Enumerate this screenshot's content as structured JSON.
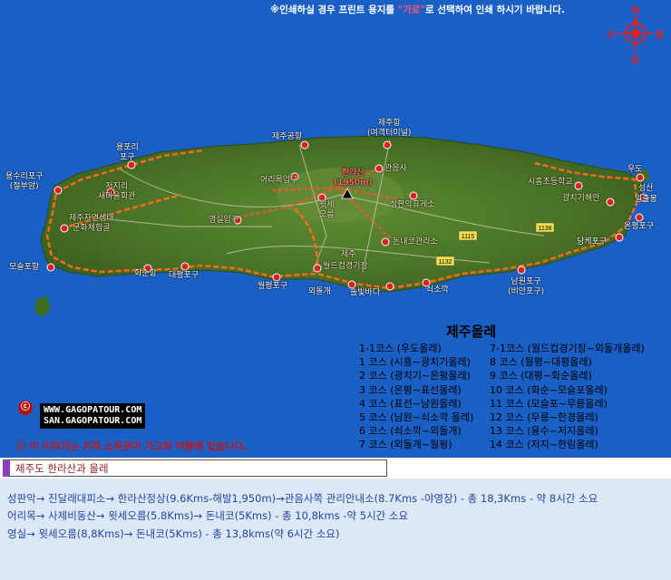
{
  "notice": {
    "before": "※인쇄하실 경우 프린트 용지를 ",
    "highlight": "\"가로\"",
    "after": "로 선택하여 인쇄 하시기 바랍니다."
  },
  "compass": {
    "north": "북",
    "south": "남",
    "west": "서",
    "east": "동"
  },
  "places": {
    "jeju_port": "제주항\n(여객터미널)",
    "jeju_airport": "제주공항",
    "yongpori": "용포리\n포구",
    "yongsuri": "용수리포구\n(절부암)",
    "jeojiri": "저지리\n새마을회관",
    "jeju_eco": "제주자연생태\n문화체험골",
    "moseulpo": "모슬포항",
    "hwasun": "화순항",
    "daepyeong": "대평포구",
    "woljeong": "월평포구",
    "oedolgae": "외돌개",
    "solbat": "솔빛바다",
    "soesokkak": "쇠소깍",
    "namwon": "남원포구\n(비안포구)",
    "worldcup": "월드컵경기장",
    "jeju_mid": "제주",
    "donnaeko": "돈내코관리소",
    "hallasan": "한라산\n(1950m)",
    "gwaneumsa": "관음사",
    "eorimok": "어리목입구",
    "yeongsil": "영실입구",
    "witse": "윗세\n오름",
    "seongpanak": "성판악휴게소",
    "sihung": "시흥초등학교",
    "gwangchigi": "광치기해안",
    "udo": "우도",
    "seongsan": "성산",
    "onpyeong": "온평포구",
    "pyoseon": "당케포구",
    "inchul": "일출봉"
  },
  "road_numbers": {
    "r1115": "1115",
    "r1132": "1132",
    "r1138": "1138"
  },
  "legend": {
    "title": "제주올레",
    "left": [
      "1-1코스 (우도올레)",
      "1 코스 (시흥~광치기올레)",
      "2 코스 (광치기~온평올레)",
      "3 코스 (온평~표선올레)",
      "4 코스 (표선~남원올레)",
      "5 코스 (남원~쇠소깍 올레)",
      "6 코스 (쇠소깍~외돌개)",
      "7 코스 (외돌개~월평)"
    ],
    "right": [
      "7-1코스 (월드컵경기장~외돌개올레)",
      "8 코스 (월평~대평올레)",
      "9 코스 (대평~화순올레)",
      "10 코스 (화순~모슬포올레)",
      "11 코스 (모슬포~무릉올레)",
      "12 코스 (무릉~한경올레)",
      "13 코스 (용수~저지올레)",
      "14 코스 (저지~한림올레)"
    ]
  },
  "site": {
    "line1": "WWW.GAGOPATOUR.COM",
    "line2": "SAN.GAGOPATOUR.COM",
    "icon": "ⓒ"
  },
  "copyright": "ⓒ 이 이미지는 지적 소유권이 가고파 여행에 있습니다.",
  "caption": "제주도 한라산과 올레",
  "routes": [
    "성판악→ 진달래대피소→ 한라산정상(9.6Kms-해발1,950m)→관음사쪽 관리안내소(8.7Kms -야영장) - 총 18,3Kms - 약 8시간 소요",
    "어리목→ 사제비동산→ 윗세오름(5.8Kms)→ 돈내코(5Kms) - 총 10,8kms -약 5시간 소요",
    "영실→ 윗세오름(8,8Kms)→ 돈내코(5Kms) - 총 13,8kms(약 6시간 소요)"
  ],
  "colors": {
    "sea": "#1a5fc4",
    "land": "#4f7a2a",
    "trail": "#ff6a1a",
    "marker": "#e02020",
    "caption_bar": "#8d3fc2"
  }
}
